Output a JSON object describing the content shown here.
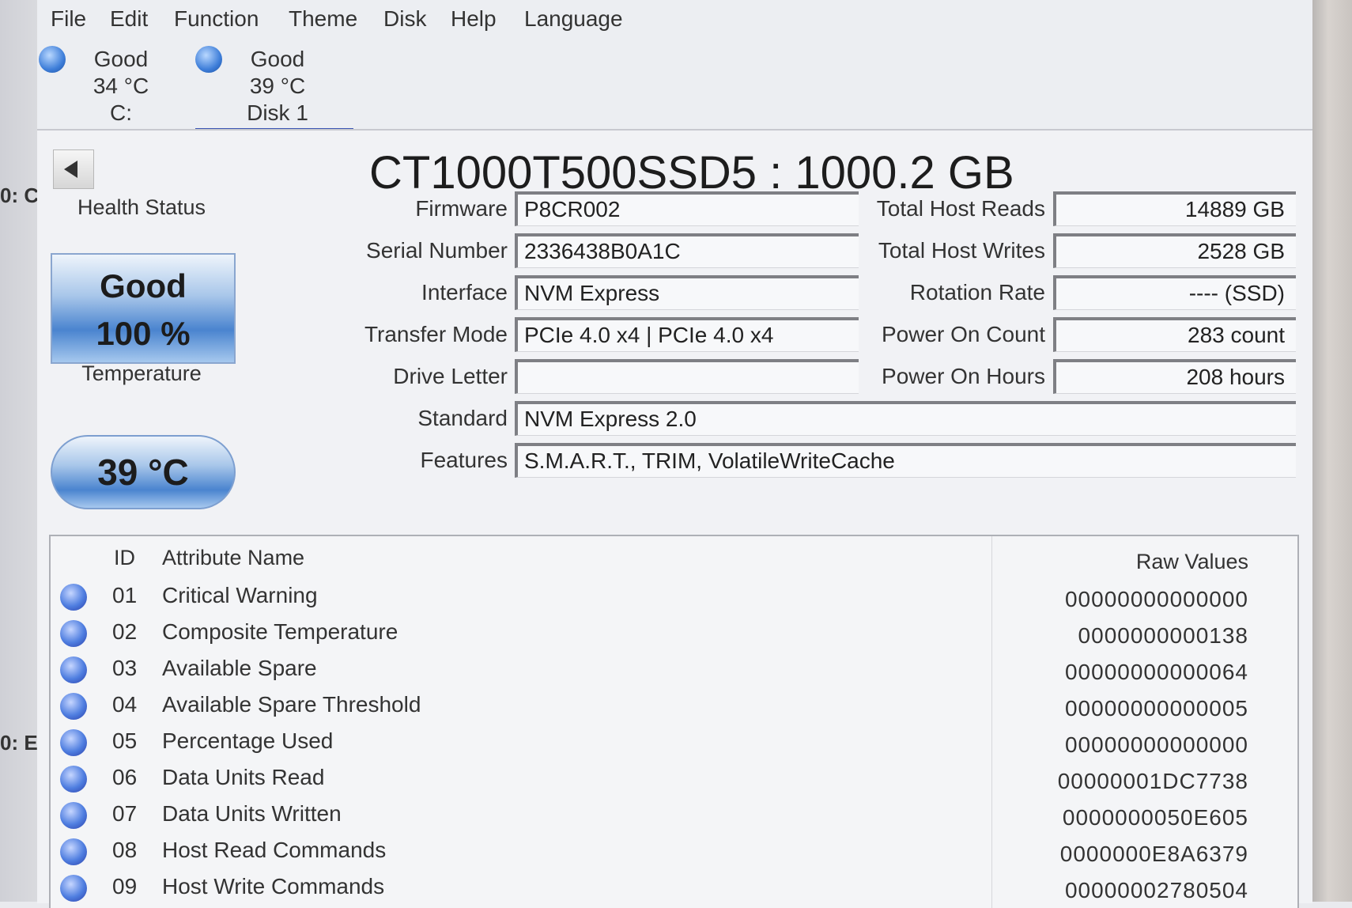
{
  "background_fragments": [
    "0: C",
    "0: E"
  ],
  "menu": [
    "File",
    "Edit",
    "Function",
    "Theme",
    "Disk",
    "Help",
    "Language"
  ],
  "disks": [
    {
      "status": "Good",
      "temp": "34 °C",
      "name": "C:"
    },
    {
      "status": "Good",
      "temp": "39 °C",
      "name": "Disk 1"
    }
  ],
  "title": "CT1000T500SSD5 : 1000.2 GB",
  "health": {
    "label": "Health Status",
    "status": "Good",
    "percent": "100 %"
  },
  "temperature": {
    "label": "Temperature",
    "value": "39 °C"
  },
  "fields": {
    "firmware": {
      "label": "Firmware",
      "value": "P8CR002"
    },
    "serial": {
      "label": "Serial Number",
      "value": "2336438B0A1C"
    },
    "interface": {
      "label": "Interface",
      "value": "NVM Express"
    },
    "transfer_mode": {
      "label": "Transfer Mode",
      "value": "PCIe 4.0 x4 | PCIe 4.0 x4"
    },
    "drive_letter": {
      "label": "Drive Letter",
      "value": ""
    },
    "standard": {
      "label": "Standard",
      "value": "NVM Express 2.0"
    },
    "features": {
      "label": "Features",
      "value": "S.M.A.R.T., TRIM, VolatileWriteCache"
    },
    "host_reads": {
      "label": "Total Host Reads",
      "value": "14889 GB"
    },
    "host_writes": {
      "label": "Total Host Writes",
      "value": "2528 GB"
    },
    "rotation": {
      "label": "Rotation Rate",
      "value": "---- (SSD)"
    },
    "power_count": {
      "label": "Power On Count",
      "value": "283 count"
    },
    "power_hours": {
      "label": "Power On Hours",
      "value": "208 hours"
    }
  },
  "table": {
    "headers": {
      "id": "ID",
      "name": "Attribute Name",
      "raw": "Raw Values"
    },
    "rows": [
      {
        "id": "01",
        "name": "Critical Warning",
        "raw": "00000000000000"
      },
      {
        "id": "02",
        "name": "Composite Temperature",
        "raw": "0000000000138"
      },
      {
        "id": "03",
        "name": "Available Spare",
        "raw": "00000000000064"
      },
      {
        "id": "04",
        "name": "Available Spare Threshold",
        "raw": "00000000000005"
      },
      {
        "id": "05",
        "name": "Percentage Used",
        "raw": "00000000000000"
      },
      {
        "id": "06",
        "name": "Data Units Read",
        "raw": "00000001DC7738"
      },
      {
        "id": "07",
        "name": "Data Units Written",
        "raw": "0000000050E605"
      },
      {
        "id": "08",
        "name": "Host Read Commands",
        "raw": "0000000E8A6379"
      },
      {
        "id": "09",
        "name": "Host Write Commands",
        "raw": "00000002780504"
      }
    ]
  },
  "colors": {
    "status_good": "#3e7ed9",
    "active_tab_underline": "#3b55b3"
  }
}
